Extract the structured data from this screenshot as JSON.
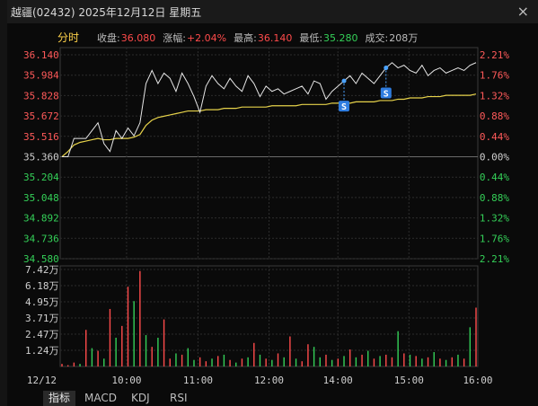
{
  "window": {
    "title": "越疆(02432)  2025年12月12日  星期五",
    "close_glyph": "×"
  },
  "header": {
    "tab": "分时",
    "close_label": "收盘:",
    "close_value": "36.080",
    "change_label": "涨幅:",
    "change_value": "+2.04%",
    "high_label": "最高:",
    "high_value": "36.140",
    "low_label": "最低:",
    "low_value": "35.280",
    "volume_label": "成交:",
    "volume_value": "208万"
  },
  "chart_data": {
    "type": "line",
    "price_axis": {
      "ticks": [
        "36.140",
        "35.984",
        "35.828",
        "35.672",
        "35.516",
        "35.360",
        "35.204",
        "35.048",
        "34.892",
        "34.736",
        "34.580"
      ],
      "ylim": [
        34.58,
        36.14
      ],
      "prev_close": 35.36
    },
    "pct_axis": [
      "2.21%",
      "1.76%",
      "1.32%",
      "0.88%",
      "0.44%",
      "0.00%",
      "0.44%",
      "0.88%",
      "1.32%",
      "1.76%",
      "2.21%"
    ],
    "volume_axis": [
      "7.42万",
      "6.18万",
      "4.95万",
      "3.71万",
      "2.47万",
      "1.24万"
    ],
    "x_ticks": [
      "12/12",
      "10:00",
      "11:00",
      "12:00",
      "14:00",
      "15:00",
      "16:00"
    ],
    "markers": [
      "S",
      "S"
    ],
    "colors": {
      "price": "#e6e6e6",
      "avg": "#e6d24a",
      "up": "#ff4b4b",
      "down": "#34d058",
      "grid": "#303030"
    },
    "series": [
      {
        "values": [
          35.36,
          35.36,
          35.5,
          35.5,
          35.5,
          35.56,
          35.62,
          35.46,
          35.4,
          35.56,
          35.5,
          35.58,
          35.52,
          35.62,
          35.92,
          36.02,
          35.92,
          36.0,
          35.96,
          35.86,
          36.0,
          35.92,
          35.82,
          35.7,
          35.9,
          35.98,
          35.92,
          35.88,
          35.96,
          35.9,
          35.86,
          35.98,
          35.92,
          35.82,
          35.9,
          35.86,
          35.88,
          35.84,
          35.86,
          35.88,
          35.9,
          35.84,
          35.94,
          35.92,
          35.8,
          35.86,
          35.9,
          35.94,
          35.98,
          35.92,
          36.0,
          35.96,
          35.92,
          35.98,
          36.04,
          36.08,
          36.04,
          36.06,
          36.02,
          36.0,
          36.06,
          35.98,
          36.02,
          36.04,
          36.0,
          36.02,
          36.04,
          36.02,
          36.06,
          36.08
        ]
      },
      {
        "values": [
          35.36,
          35.4,
          35.45,
          35.47,
          35.48,
          35.49,
          35.5,
          35.49,
          35.49,
          35.5,
          35.5,
          35.5,
          35.51,
          35.53,
          35.6,
          35.64,
          35.66,
          35.67,
          35.68,
          35.69,
          35.7,
          35.71,
          35.71,
          35.71,
          35.72,
          35.72,
          35.72,
          35.73,
          35.73,
          35.73,
          35.74,
          35.74,
          35.74,
          35.74,
          35.74,
          35.75,
          35.75,
          35.75,
          35.75,
          35.75,
          35.76,
          35.76,
          35.76,
          35.76,
          35.76,
          35.77,
          35.77,
          35.77,
          35.77,
          35.78,
          35.78,
          35.78,
          35.78,
          35.79,
          35.79,
          35.79,
          35.8,
          35.8,
          35.81,
          35.81,
          35.81,
          35.82,
          35.82,
          35.82,
          35.83,
          35.83,
          35.83,
          35.83,
          35.83,
          35.84
        ]
      }
    ],
    "volume": [
      0.2,
      0.1,
      0.3,
      0.2,
      2.8,
      1.4,
      1.2,
      0.6,
      4.4,
      2.2,
      3.1,
      6.1,
      5.0,
      7.3,
      2.4,
      1.5,
      2.2,
      3.6,
      0.6,
      1.0,
      0.9,
      1.4,
      0.5,
      0.7,
      0.4,
      0.6,
      0.8,
      0.9,
      0.5,
      0.3,
      0.6,
      0.7,
      1.8,
      0.9,
      0.6,
      0.5,
      1.0,
      0.7,
      2.3,
      0.6,
      0.4,
      1.7,
      1.5,
      0.7,
      0.9,
      0.5,
      0.6,
      0.8,
      1.3,
      0.7,
      0.9,
      1.2,
      0.6,
      0.8,
      0.9,
      0.7,
      2.7,
      1.0,
      0.9,
      0.8,
      0.6,
      0.7,
      1.1,
      0.6,
      0.5,
      0.7,
      0.9,
      0.6,
      3.0,
      4.5
    ],
    "volume_up": [
      1,
      1,
      1,
      0,
      1,
      0,
      1,
      0,
      1,
      0,
      1,
      1,
      0,
      1,
      0,
      1,
      0,
      1,
      1,
      0,
      1,
      0,
      0,
      1,
      1,
      0,
      1,
      0,
      1,
      0,
      1,
      0,
      1,
      0,
      1,
      0,
      1,
      0,
      1,
      0,
      1,
      1,
      0,
      0,
      1,
      0,
      1,
      0,
      1,
      0,
      1,
      0,
      1,
      0,
      1,
      1,
      0,
      1,
      0,
      1,
      0,
      1,
      0,
      1,
      0,
      1,
      0,
      1,
      0,
      1
    ]
  },
  "bottom_tabs": [
    "指标",
    "MACD",
    "KDJ",
    "RSI"
  ]
}
